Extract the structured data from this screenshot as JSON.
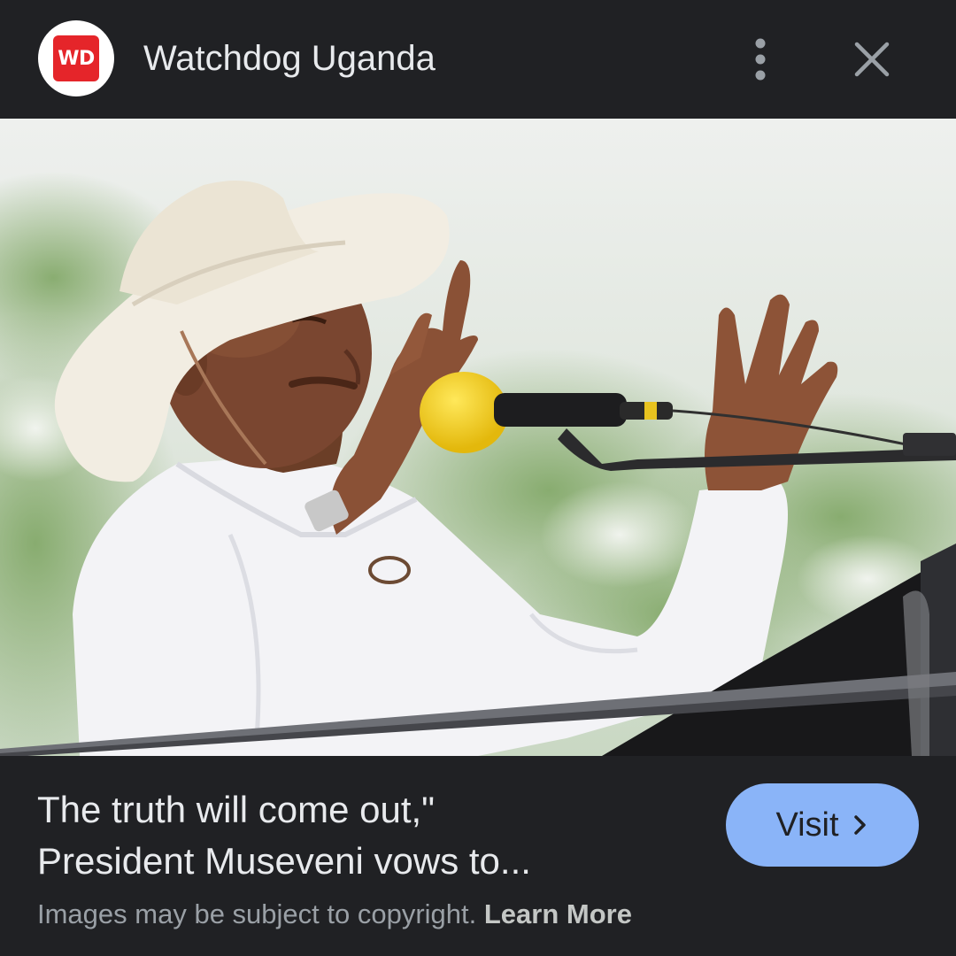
{
  "header": {
    "logo_text": "WD",
    "site_name": "Watchdog Uganda",
    "more_icon": "more-vert-icon",
    "close_icon": "close-icon"
  },
  "image": {
    "content": "news-photo"
  },
  "caption": {
    "line1": "The truth will come out,\"",
    "line2": "President Museveni vows to..."
  },
  "visit_button": {
    "label": "Visit",
    "icon": "chevron-right-icon"
  },
  "footer": {
    "copyright_text": "Images may be subject to copyright.",
    "learn_more_label": "Learn More"
  },
  "colors": {
    "background": "#202124",
    "logo_red": "#e5252a",
    "visit_button": "#8ab4f8",
    "text_primary": "#e8eaed",
    "text_secondary": "#9aa0a6"
  }
}
